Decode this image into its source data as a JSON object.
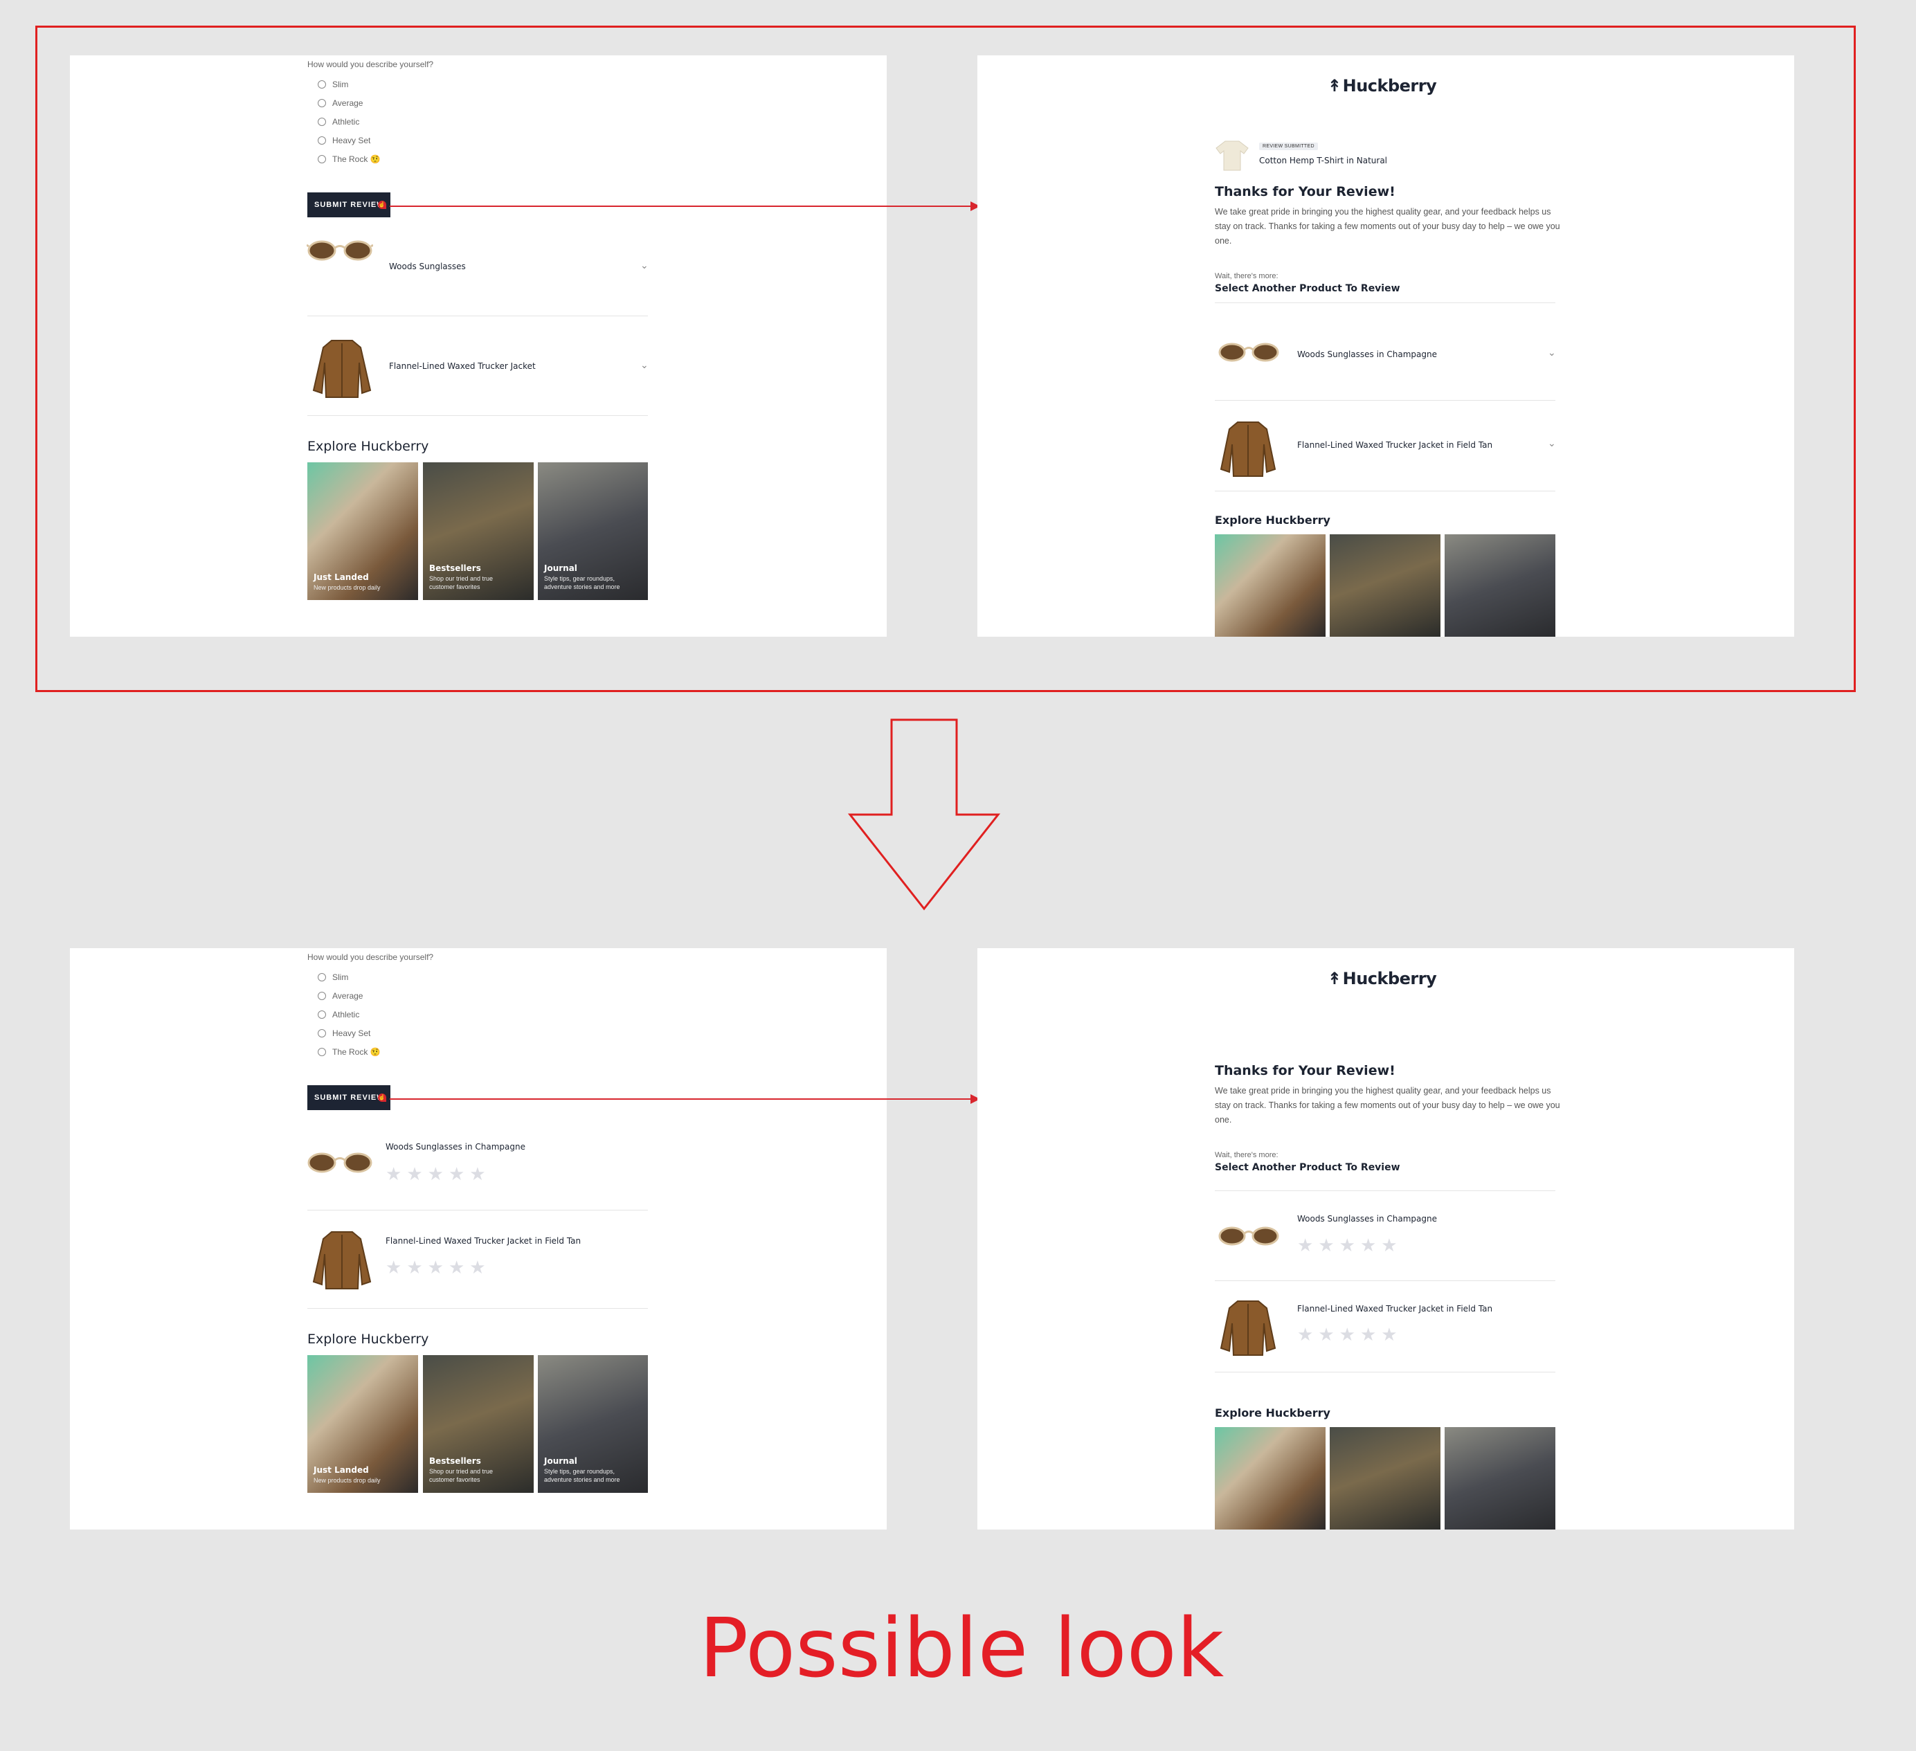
{
  "form": {
    "question": "How would you describe yourself?",
    "options": [
      "Slim",
      "Average",
      "Athletic",
      "Heavy Set",
      "The Rock 🤨"
    ],
    "submit_label": "SUBMIT REVIEW"
  },
  "before": {
    "left_products": [
      "Woods Sunglasses",
      "Flannel-Lined Waxed Trucker Jacket"
    ],
    "right_products": [
      "Woods Sunglasses in Champagne",
      "Flannel-Lined Waxed Trucker Jacket in Field Tan"
    ]
  },
  "after": {
    "left_products": [
      "Woods Sunglasses in Champagne",
      "Flannel-Lined Waxed Trucker Jacket in Field Tan"
    ],
    "right_products": [
      "Woods Sunglasses in Champagne",
      "Flannel-Lined Waxed Trucker Jacket in Field Tan"
    ]
  },
  "explore": {
    "heading": "Explore Huckberry",
    "tiles": [
      {
        "title": "Just Landed",
        "subtitle": "New products drop daily"
      },
      {
        "title": "Bestsellers",
        "subtitle": "Shop our tried and true customer favorites"
      },
      {
        "title": "Journal",
        "subtitle": "Style tips, gear roundups, adventure stories and more"
      }
    ]
  },
  "confirmation": {
    "logo": "Huckberry",
    "badge": "REVIEW SUBMITTED",
    "reviewed_product": "Cotton Hemp T-Shirt in Natural",
    "heading": "Thanks for Your Review!",
    "body": "We take great pride in bringing you the highest quality gear, and your feedback helps us stay on track. Thanks for taking a few moments out of your busy day to help – we owe you one.",
    "wait": "Wait, there's more:",
    "select_heading": "Select Another Product To Review"
  },
  "caption": "Possible look",
  "rating": {
    "stars_total": 5,
    "stars_filled": 0
  },
  "colors": {
    "annotation_red": "#e02020",
    "button_navy": "#1d2433"
  }
}
